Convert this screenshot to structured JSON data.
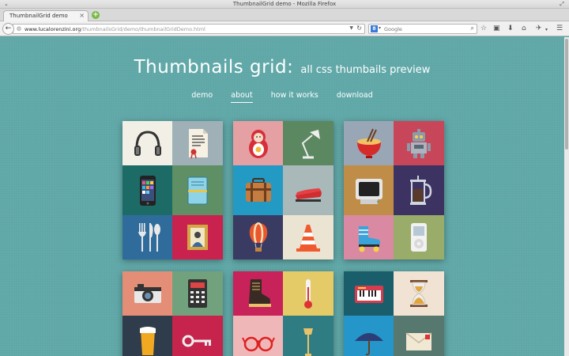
{
  "browser": {
    "window_title": "ThumbnailGrid demo - Mozilla Firefox",
    "tab_label": "ThumbnailGrid demo",
    "url_domain": "www.lucalorenzini.org",
    "url_path": "/thumbnailsGrid/demo/thumbnailGridDemo.html",
    "search_placeholder": "Google",
    "search_engine_letter": "8"
  },
  "page": {
    "title": "Thumbnails grid:",
    "subtitle": "all css thumbails preview",
    "menu": [
      {
        "label": "demo",
        "active": false
      },
      {
        "label": "about",
        "active": true
      },
      {
        "label": "how it works",
        "active": false
      },
      {
        "label": "download",
        "active": false
      }
    ]
  },
  "colors": {
    "page_background": "#5fa7a7",
    "accent_white": "#ffffff"
  },
  "cards": [
    {
      "name": "card-1",
      "thumbs": [
        {
          "icon": "headphones-icon",
          "bg": "#f2efe6"
        },
        {
          "icon": "document-icon",
          "bg": "#9fb0b6"
        },
        {
          "icon": "smartphone-icon",
          "bg": "#1d6b66"
        },
        {
          "icon": "notebook-icon",
          "bg": "#5f8f65"
        },
        {
          "icon": "cutlery-icon",
          "bg": "#2f6c9c"
        },
        {
          "icon": "picture-frame-icon",
          "bg": "#c9224f"
        }
      ]
    },
    {
      "name": "card-2",
      "thumbs": [
        {
          "icon": "matryoshka-icon",
          "bg": "#e4a0a3"
        },
        {
          "icon": "desk-lamp-icon",
          "bg": "#5b8861"
        },
        {
          "icon": "suitcase-icon",
          "bg": "#239ac4"
        },
        {
          "icon": "stapler-icon",
          "bg": "#a9b8b8"
        },
        {
          "icon": "hot-air-balloon-icon",
          "bg": "#3a3b63"
        },
        {
          "icon": "traffic-cone-icon",
          "bg": "#ece4d2"
        }
      ]
    },
    {
      "name": "card-3",
      "thumbs": [
        {
          "icon": "noodle-bowl-icon",
          "bg": "#98a6b5"
        },
        {
          "icon": "robot-icon",
          "bg": "#c8465a"
        },
        {
          "icon": "computer-monitor-icon",
          "bg": "#bf8d48"
        },
        {
          "icon": "french-press-icon",
          "bg": "#3d3363"
        },
        {
          "icon": "roller-skate-icon",
          "bg": "#d98aa2"
        },
        {
          "icon": "ipod-icon",
          "bg": "#9aac69"
        }
      ]
    },
    {
      "name": "card-4",
      "thumbs": [
        {
          "icon": "camera-icon",
          "bg": "#e58e77"
        },
        {
          "icon": "calculator-icon",
          "bg": "#71a27d"
        },
        {
          "icon": "beer-glass-icon",
          "bg": "#2f3c4b"
        },
        {
          "icon": "key-icon",
          "bg": "#c6234d"
        }
      ]
    },
    {
      "name": "card-5",
      "thumbs": [
        {
          "icon": "boot-icon",
          "bg": "#c8225a"
        },
        {
          "icon": "thermometer-icon",
          "bg": "#e5cb67"
        },
        {
          "icon": "glasses-icon",
          "bg": "#f0b7b9"
        },
        {
          "icon": "street-lamp-icon",
          "bg": "#2f7c83"
        }
      ]
    },
    {
      "name": "card-6",
      "thumbs": [
        {
          "icon": "keyboard-piano-icon",
          "bg": "#1b5e6b"
        },
        {
          "icon": "hourglass-icon",
          "bg": "#f1e3d4"
        },
        {
          "icon": "umbrella-icon",
          "bg": "#2596c9"
        },
        {
          "icon": "envelope-icon",
          "bg": "#56786f"
        }
      ]
    }
  ]
}
